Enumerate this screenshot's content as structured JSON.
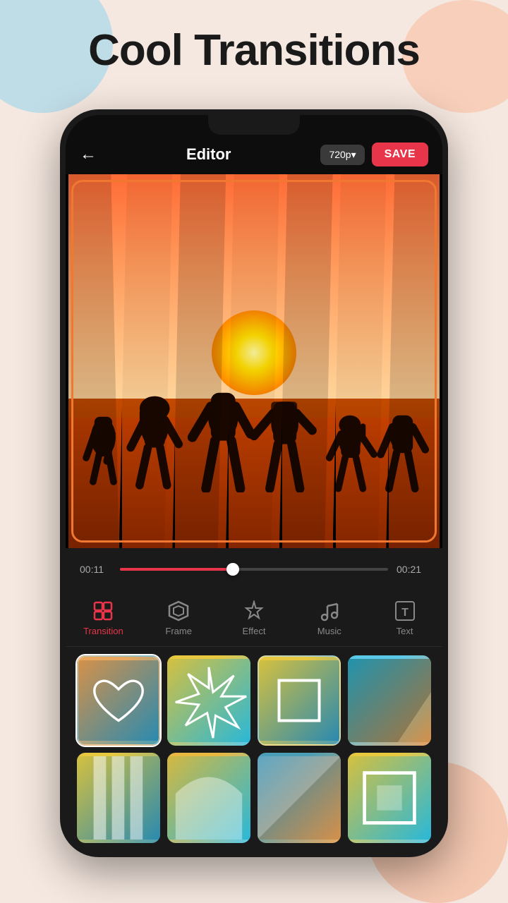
{
  "page": {
    "title": "Cool Transitions",
    "background_color": "#f5e8e0"
  },
  "header": {
    "back_label": "←",
    "title": "Editor",
    "quality": "720p▾",
    "save_label": "SAVE"
  },
  "timeline": {
    "time_start": "00:11",
    "time_end": "00:21",
    "progress_percent": 42
  },
  "tools": [
    {
      "id": "transition",
      "label": "Transition",
      "icon": "⧉",
      "active": true
    },
    {
      "id": "frame",
      "label": "Frame",
      "icon": "⬡",
      "active": false
    },
    {
      "id": "effect",
      "label": "Effect",
      "icon": "✦",
      "active": false
    },
    {
      "id": "music",
      "label": "Music",
      "icon": "♫",
      "active": false
    },
    {
      "id": "text",
      "label": "Text",
      "icon": "T",
      "active": false
    }
  ],
  "transitions": [
    {
      "id": 1,
      "type": "heart",
      "selected": true
    },
    {
      "id": 2,
      "type": "starburst",
      "selected": false
    },
    {
      "id": 3,
      "type": "frame",
      "selected": false
    },
    {
      "id": 4,
      "type": "diagonal-blue",
      "selected": false
    },
    {
      "id": 5,
      "type": "vertical-bars",
      "selected": false
    },
    {
      "id": 6,
      "type": "arch",
      "selected": false
    },
    {
      "id": 7,
      "type": "diagonal",
      "selected": false
    },
    {
      "id": 8,
      "type": "frame-box",
      "selected": false
    }
  ]
}
